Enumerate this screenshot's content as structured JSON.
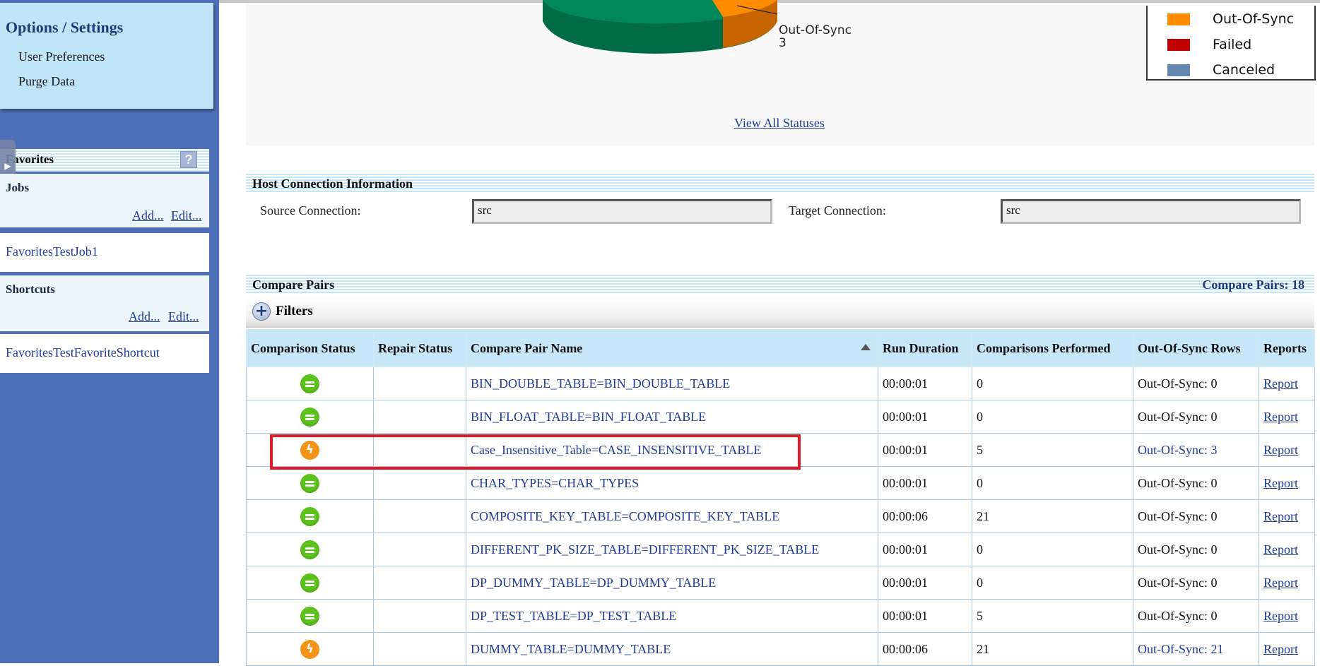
{
  "sidebar": {
    "options_title": "Options / Settings",
    "options_links": [
      "User Preferences",
      "Purge Data"
    ],
    "favorites_title": "Favorites",
    "help_icon": "?",
    "jobs": {
      "title": "Jobs",
      "add_label": "Add...",
      "edit_label": "Edit...",
      "item": "FavoritesTestJob1"
    },
    "shortcuts": {
      "title": "Shortcuts",
      "add_label": "Add...",
      "edit_label": "Edit...",
      "item": "FavoritesTestFavoriteShortcut"
    }
  },
  "status_chart": {
    "legend": [
      {
        "label": "Out-Of-Sync",
        "color": "#ff8c00"
      },
      {
        "label": "Failed",
        "color": "#c00000"
      },
      {
        "label": "Canceled",
        "color": "#6487b0"
      }
    ],
    "slice_label": "Out-Of-Sync",
    "slice_value": "3",
    "view_all_link": "View All Statuses"
  },
  "host_connection": {
    "title": "Host Connection Information",
    "source_label": "Source Connection:",
    "source_value": "src",
    "target_label": "Target Connection:",
    "target_value": "src"
  },
  "compare_pairs": {
    "title": "Compare Pairs",
    "count_label": "Compare Pairs: 18",
    "filters_label": "Filters",
    "columns": [
      "Comparison Status",
      "Repair Status",
      "Compare Pair Name",
      "Run Duration",
      "Comparisons Performed",
      "Out-Of-Sync Rows",
      "Reports"
    ],
    "rows": [
      {
        "status": "in-sync",
        "repair": "",
        "name": "BIN_DOUBLE_TABLE=BIN_DOUBLE_TABLE",
        "duration": "00:00:01",
        "comparisons": "0",
        "oos": "Out-Of-Sync: 0",
        "report": "Report"
      },
      {
        "status": "in-sync",
        "repair": "",
        "name": "BIN_FLOAT_TABLE=BIN_FLOAT_TABLE",
        "duration": "00:00:01",
        "comparisons": "0",
        "oos": "Out-Of-Sync: 0",
        "report": "Report"
      },
      {
        "status": "out-of-sync",
        "repair": "",
        "name": "Case_Insensitive_Table=CASE_INSENSITIVE_TABLE",
        "duration": "00:00:01",
        "comparisons": "5",
        "oos": "Out-Of-Sync: 3",
        "report": "Report"
      },
      {
        "status": "in-sync",
        "repair": "",
        "name": "CHAR_TYPES=CHAR_TYPES",
        "duration": "00:00:01",
        "comparisons": "0",
        "oos": "Out-Of-Sync: 0",
        "report": "Report"
      },
      {
        "status": "in-sync",
        "repair": "",
        "name": "COMPOSITE_KEY_TABLE=COMPOSITE_KEY_TABLE",
        "duration": "00:00:06",
        "comparisons": "21",
        "oos": "Out-Of-Sync: 0",
        "report": "Report"
      },
      {
        "status": "in-sync",
        "repair": "",
        "name": "DIFFERENT_PK_SIZE_TABLE=DIFFERENT_PK_SIZE_TABLE",
        "duration": "00:00:01",
        "comparisons": "0",
        "oos": "Out-Of-Sync: 0",
        "report": "Report"
      },
      {
        "status": "in-sync",
        "repair": "",
        "name": "DP_DUMMY_TABLE=DP_DUMMY_TABLE",
        "duration": "00:00:01",
        "comparisons": "0",
        "oos": "Out-Of-Sync: 0",
        "report": "Report"
      },
      {
        "status": "in-sync",
        "repair": "",
        "name": "DP_TEST_TABLE=DP_TEST_TABLE",
        "duration": "00:00:01",
        "comparisons": "5",
        "oos": "Out-Of-Sync: 0",
        "report": "Report"
      },
      {
        "status": "out-of-sync",
        "repair": "",
        "name": "DUMMY_TABLE=DUMMY_TABLE",
        "duration": "00:00:06",
        "comparisons": "21",
        "oos": "Out-Of-Sync: 21",
        "report": "Report"
      }
    ]
  },
  "colors": {
    "sidebar_bg": "#4e6eb8",
    "header_bg": "#c7e7f8",
    "link": "#1f3b9a",
    "highlight": "#e0192b",
    "in_sync": "#5cc21c",
    "out_of_sync": "#f39418"
  }
}
